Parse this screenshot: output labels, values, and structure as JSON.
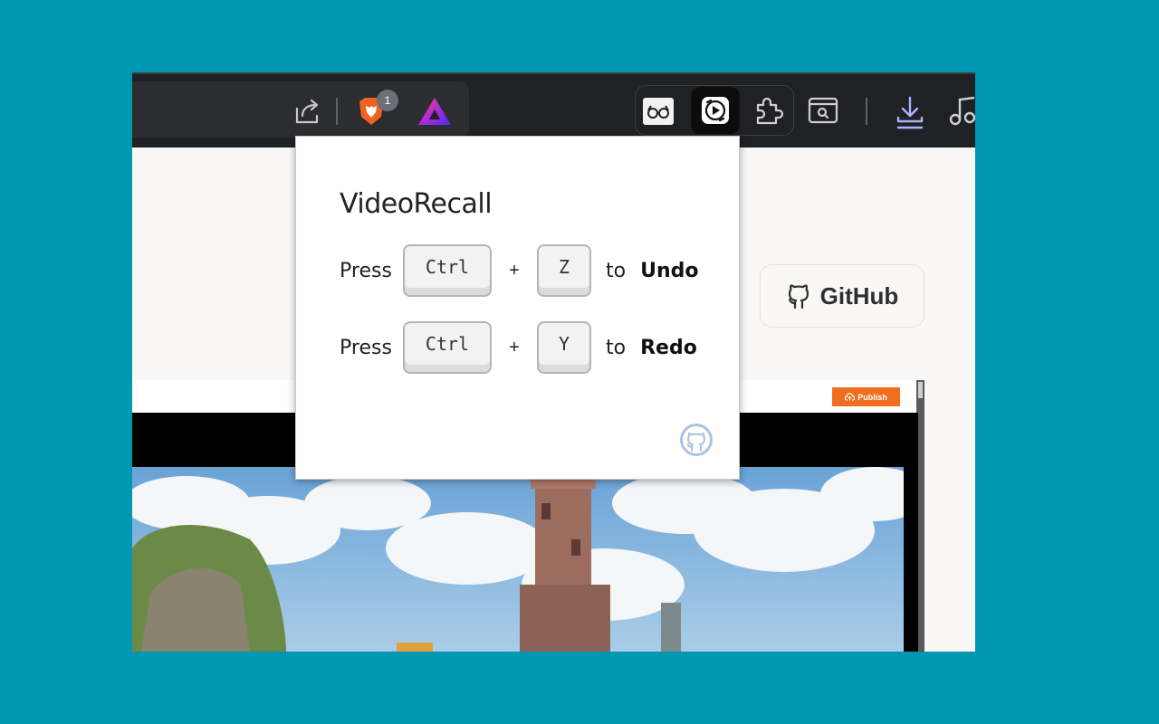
{
  "toolbar": {
    "shields_badge_count": "1",
    "icons": [
      "share-icon",
      "brave-shields-icon",
      "brave-rewards-icon",
      "reader-mode-icon",
      "videorecall-extension-icon",
      "extensions-puzzle-icon",
      "tab-search-icon",
      "downloads-icon",
      "media-controls-icon"
    ]
  },
  "page": {
    "github_button_label": "GitHub",
    "publish_label": "Publish"
  },
  "popup": {
    "title": "VideoRecall",
    "rows": [
      {
        "press": "Press",
        "key1": "Ctrl",
        "plus": "+",
        "key2": "Z",
        "to": "to",
        "action": "Undo"
      },
      {
        "press": "Press",
        "key1": "Ctrl",
        "plus": "+",
        "key2": "Y",
        "to": "to",
        "action": "Redo"
      }
    ]
  },
  "colors": {
    "background": "#0097b2",
    "toolbar": "#202124",
    "publish": "#f06e1f",
    "downloads_accent": "#a8b4ff"
  }
}
